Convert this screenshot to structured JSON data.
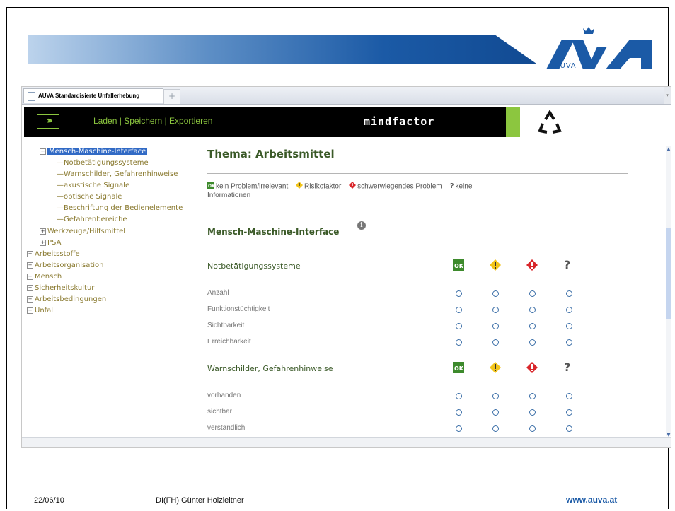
{
  "browser": {
    "tab_title": "AUVA Standardisierte Unfallerhebung",
    "new_tab": "+"
  },
  "app": {
    "menu": {
      "load": "Laden",
      "save": "Speichern",
      "export": "Exportieren",
      "sep": "|"
    },
    "brand": "mindfactor"
  },
  "tree": {
    "selected": "Mensch-Maschine-Interface",
    "children": [
      "Notbetätigungssysteme",
      "Warnschilder, Gefahrenhinweise",
      "akustische Signale",
      "optische Signale",
      "Beschriftung der Bedienelemente",
      "Gefahrenbereiche"
    ],
    "siblings": [
      "Werkzeuge/Hilfsmittel",
      "PSA"
    ],
    "top": [
      "Arbeitsstoffe",
      "Arbeitsorganisation",
      "Mensch",
      "Sicherheitskultur",
      "Arbeitsbedingungen",
      "Unfall"
    ]
  },
  "main": {
    "title": "Thema: Arbeitsmittel",
    "legend": {
      "ok": "kein Problem/irrelevant",
      "risk": "Risikofaktor",
      "severe": "schwerwiegendes Problem",
      "unknown_1": "keine",
      "unknown_2": "Informationen"
    },
    "section": "Mensch-Maschine-Interface",
    "groups": [
      {
        "title": "Notbetätigungssysteme",
        "items": [
          "Anzahl",
          "Funktionstüchtigkeit",
          "Sichtbarkeit",
          "Erreichbarkeit"
        ]
      },
      {
        "title": "Warnschilder, Gefahrenhinweise",
        "items": [
          "vorhanden",
          "sichtbar",
          "verständlich"
        ]
      }
    ],
    "badge_ok": "OK",
    "badge_q": "?"
  },
  "footer": {
    "date": "22/06/10",
    "author": "DI(FH) Günter Holzleitner",
    "url": "www.auva.at"
  },
  "colors": {
    "accent_green": "#8cc63f",
    "brand_blue": "#1b5aa6",
    "selection": "#316ac5"
  },
  "logo": {
    "text": "AUVA"
  }
}
